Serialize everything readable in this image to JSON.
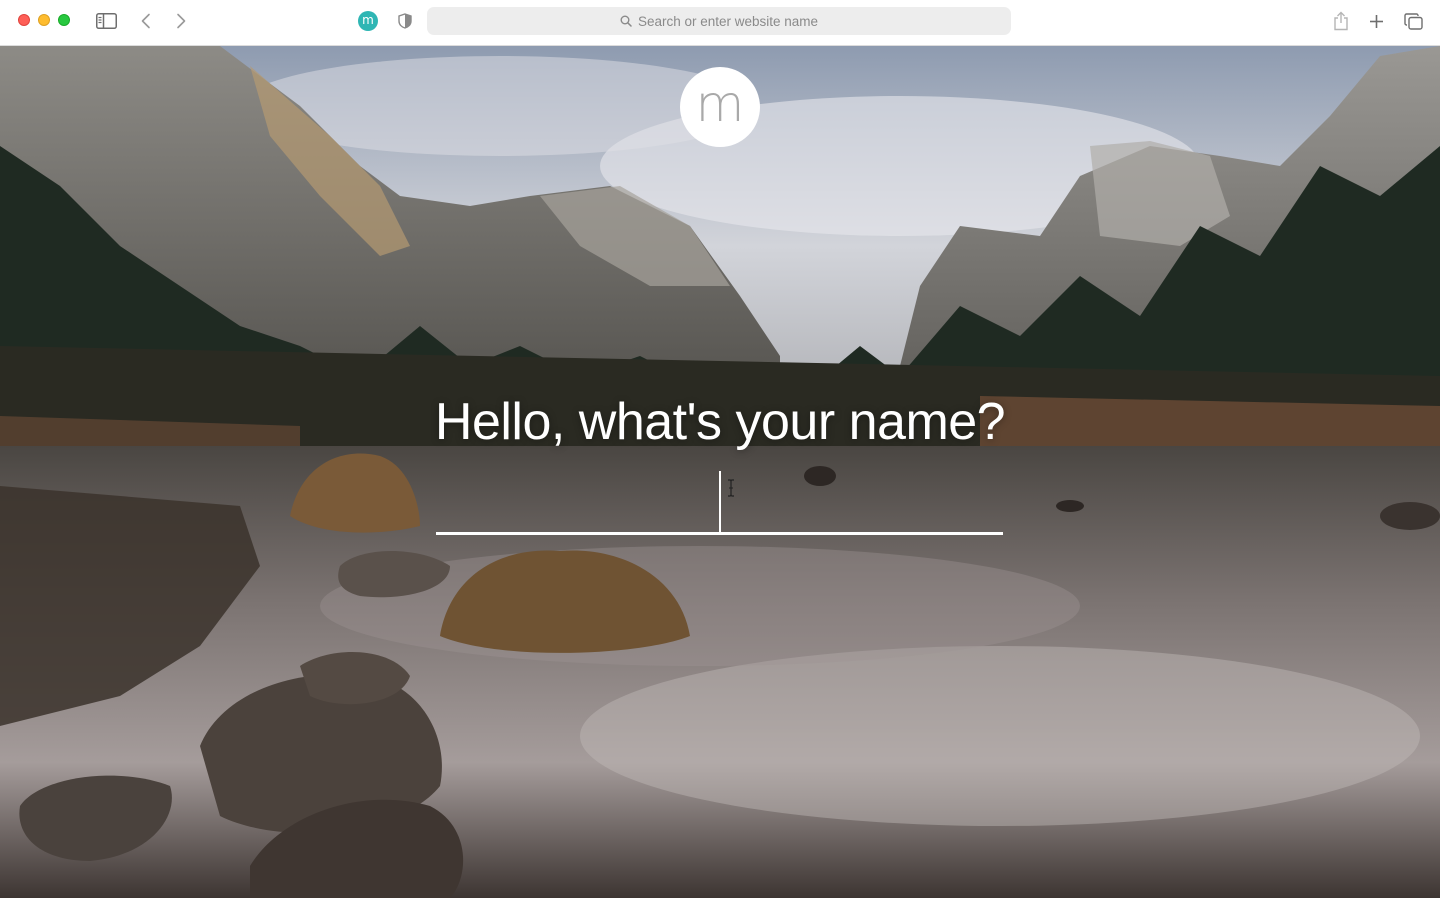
{
  "browser": {
    "address_placeholder": "Search or enter website name",
    "site_badge_letter": "m",
    "icons": [
      "sidebar-icon",
      "back-icon",
      "forward-icon",
      "privacy-shield-icon",
      "search-icon",
      "share-icon",
      "new-tab-icon",
      "tab-overview-icon"
    ]
  },
  "page": {
    "logo_letter": "m",
    "prompt": "Hello, what's your name?",
    "name_value": ""
  },
  "colors": {
    "badge": "#2fb6b4",
    "traffic_red": "#fe5f57",
    "traffic_yellow": "#febc2e",
    "traffic_green": "#28c840"
  }
}
